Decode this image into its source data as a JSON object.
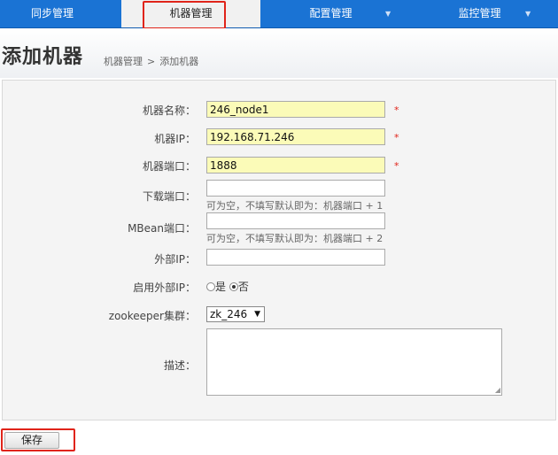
{
  "nav": {
    "items": [
      {
        "label": "同步管理",
        "dropdown": false
      },
      {
        "label": "机器管理",
        "dropdown": false,
        "active": true
      },
      {
        "label": "配置管理",
        "dropdown": true
      },
      {
        "label": "监控管理",
        "dropdown": true
      }
    ],
    "caret": "▼"
  },
  "header": {
    "title": "添加机器",
    "breadcrumb": [
      "机器管理",
      ">",
      "添加机器"
    ]
  },
  "form": {
    "machine_name": {
      "label": "机器名称：",
      "value": "246_node1",
      "required": "*"
    },
    "machine_ip": {
      "label": "机器IP：",
      "value": "192.168.71.246",
      "required": "*"
    },
    "machine_port": {
      "label": "机器端口：",
      "value": "1888",
      "required": "*"
    },
    "download_port": {
      "label": "下载端口：",
      "value": "",
      "hint": "可为空，不填写默认即为：机器端口 + 1"
    },
    "mbean_port": {
      "label": "MBean端口：",
      "value": "",
      "hint": "可为空，不填写默认即为：机器端口 + 2"
    },
    "external_ip": {
      "label": "外部IP：",
      "value": ""
    },
    "enable_external_ip": {
      "label": "启用外部IP：",
      "options": [
        "是",
        "否"
      ],
      "selected": "否"
    },
    "zookeeper_cluster": {
      "label": "zookeeper集群：",
      "selected": "zk_246",
      "arrow": "▼"
    },
    "description": {
      "label": "描述：",
      "value": ""
    }
  },
  "actions": {
    "save_label": "保存"
  },
  "colors": {
    "nav_bg": "#1a73d4",
    "highlight": "#e0241a",
    "required_field_bg": "#fbfbb8"
  }
}
